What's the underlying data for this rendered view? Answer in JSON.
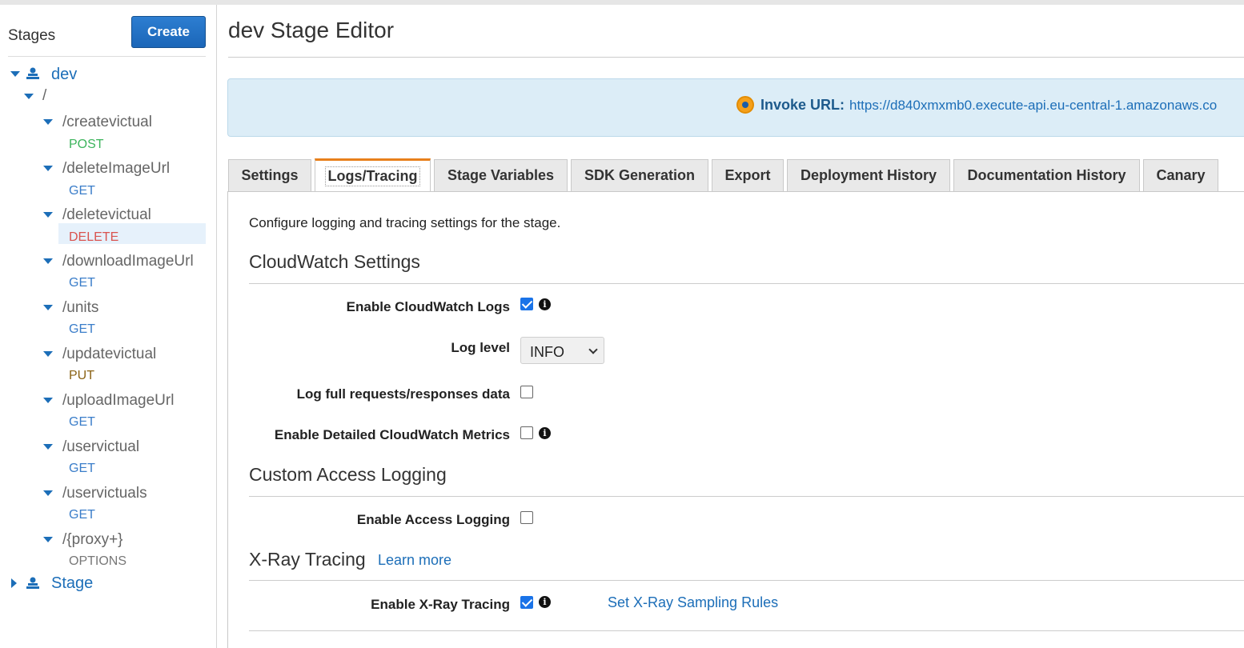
{
  "sidebar": {
    "title": "Stages",
    "create_label": "Create",
    "tree": {
      "dev": "dev",
      "root": "/",
      "resources": [
        {
          "path": "/createvictual",
          "method": "POST"
        },
        {
          "path": "/deleteImageUrl",
          "method": "GET"
        },
        {
          "path": "/deletevictual",
          "method": "DELETE"
        },
        {
          "path": "/downloadImageUrl",
          "method": "GET"
        },
        {
          "path": "/units",
          "method": "GET"
        },
        {
          "path": "/updatevictual",
          "method": "PUT"
        },
        {
          "path": "/uploadImageUrl",
          "method": "GET"
        },
        {
          "path": "/uservictual",
          "method": "GET"
        },
        {
          "path": "/uservictuals",
          "method": "GET"
        },
        {
          "path": "/{proxy+}",
          "method": "OPTIONS"
        }
      ],
      "stage2": "Stage"
    }
  },
  "main": {
    "title": "dev Stage Editor",
    "invoke": {
      "label": "Invoke URL:",
      "url": "https://d840xmxmb0.execute-api.eu-central-1.amazonaws.co"
    },
    "tabs": [
      "Settings",
      "Logs/Tracing",
      "Stage Variables",
      "SDK Generation",
      "Export",
      "Deployment History",
      "Documentation History",
      "Canary"
    ],
    "active_tab": "Logs/Tracing",
    "description": "Configure logging and tracing settings for the stage.",
    "cloudwatch": {
      "heading": "CloudWatch Settings",
      "enable_logs_label": "Enable CloudWatch Logs",
      "enable_logs": true,
      "log_level_label": "Log level",
      "log_level": "INFO",
      "full_requests_label": "Log full requests/responses data",
      "full_requests": false,
      "detailed_metrics_label": "Enable Detailed CloudWatch Metrics",
      "detailed_metrics": false
    },
    "access_logging": {
      "heading": "Custom Access Logging",
      "enable_label": "Enable Access Logging",
      "enabled": false
    },
    "xray": {
      "heading": "X-Ray Tracing",
      "learn_more": "Learn more",
      "enable_label": "Enable X-Ray Tracing",
      "enabled": true,
      "sampling_link": "Set X-Ray Sampling Rules"
    }
  },
  "colors": {
    "accent": "#1c6eb8",
    "tab_active_border": "#e8801b",
    "post": "#3cb45c",
    "get": "#3a7dc9",
    "put": "#8a6215",
    "delete": "#d9534f",
    "options": "#777777"
  }
}
